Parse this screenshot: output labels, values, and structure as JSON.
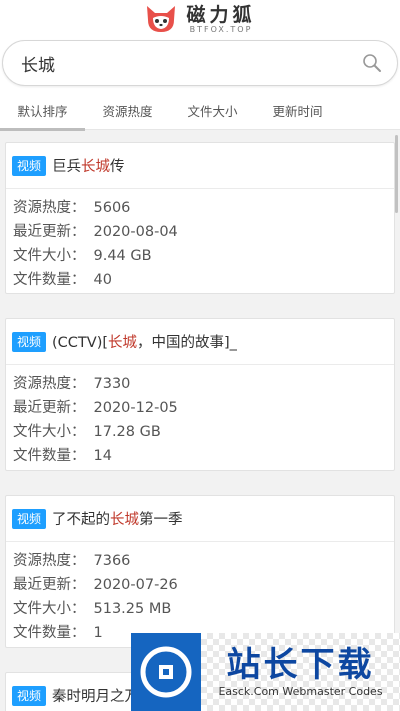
{
  "header": {
    "logo_cn": "磁力狐",
    "logo_en": "BTFOX.TOP"
  },
  "search": {
    "value": "长城"
  },
  "tabs": [
    {
      "label": "默认排序"
    },
    {
      "label": "资源热度"
    },
    {
      "label": "文件大小"
    },
    {
      "label": "更新时间"
    }
  ],
  "labels": {
    "heat": "资源热度：",
    "updated": "最近更新：",
    "size": "文件大小：",
    "count": "文件数量："
  },
  "results": [
    {
      "badge": "视频",
      "title_pre": "巨兵",
      "title_hl": "长城",
      "title_post": "传",
      "heat": "5606",
      "updated": "2020-08-04",
      "size": "9.44 GB",
      "count": "40"
    },
    {
      "badge": "视频",
      "title_pre": "(CCTV)[",
      "title_hl": "长城",
      "title_post": "，中国的故事]_",
      "heat": "7330",
      "updated": "2020-12-05",
      "size": "17.28 GB",
      "count": "14"
    },
    {
      "badge": "视频",
      "title_pre": "了不起的",
      "title_hl": "长城",
      "title_post": "第一季",
      "heat": "7366",
      "updated": "2020-07-26",
      "size": "513.25 MB",
      "count": "1"
    },
    {
      "badge": "视频",
      "title_pre": "秦时明月之万",
      "title_hl": "",
      "title_post": ""
    }
  ],
  "watermark": {
    "cn": "站长下载",
    "en": "Easck.Com Webmaster Codes"
  },
  "colors": {
    "badge": "#1e9fff",
    "highlight": "#c0392b",
    "fox": "#e8504a"
  }
}
